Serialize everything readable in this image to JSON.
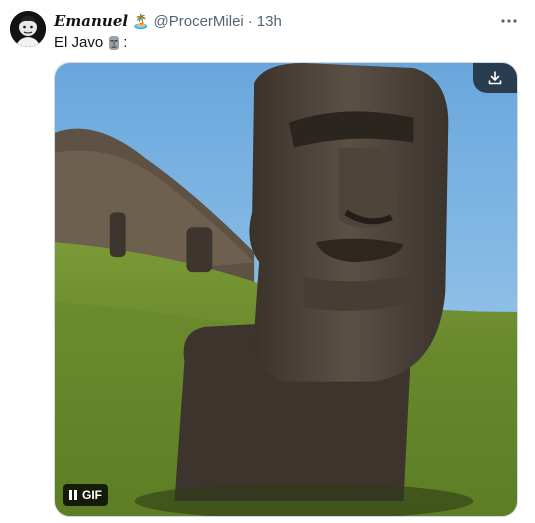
{
  "tweet": {
    "author": {
      "display_name": "Emanuel",
      "name_emoji": "🏝️",
      "handle": "@ProcerMilei",
      "separator": "·",
      "time": "13h"
    },
    "text_before": "El Javo",
    "text_after": ":"
  },
  "media": {
    "badge_label": "GIF"
  },
  "icons": {
    "more": "more-horizontal-icon",
    "download": "download-icon",
    "pause": "pause-icon",
    "moai": "moai-emoji-icon"
  },
  "colors": {
    "text_primary": "#0f1419",
    "text_secondary": "#536471",
    "media_border": "#cfd9de",
    "sky": "#7ab8e6",
    "grass": "#6b8f2c",
    "stone": "#4a4238"
  }
}
